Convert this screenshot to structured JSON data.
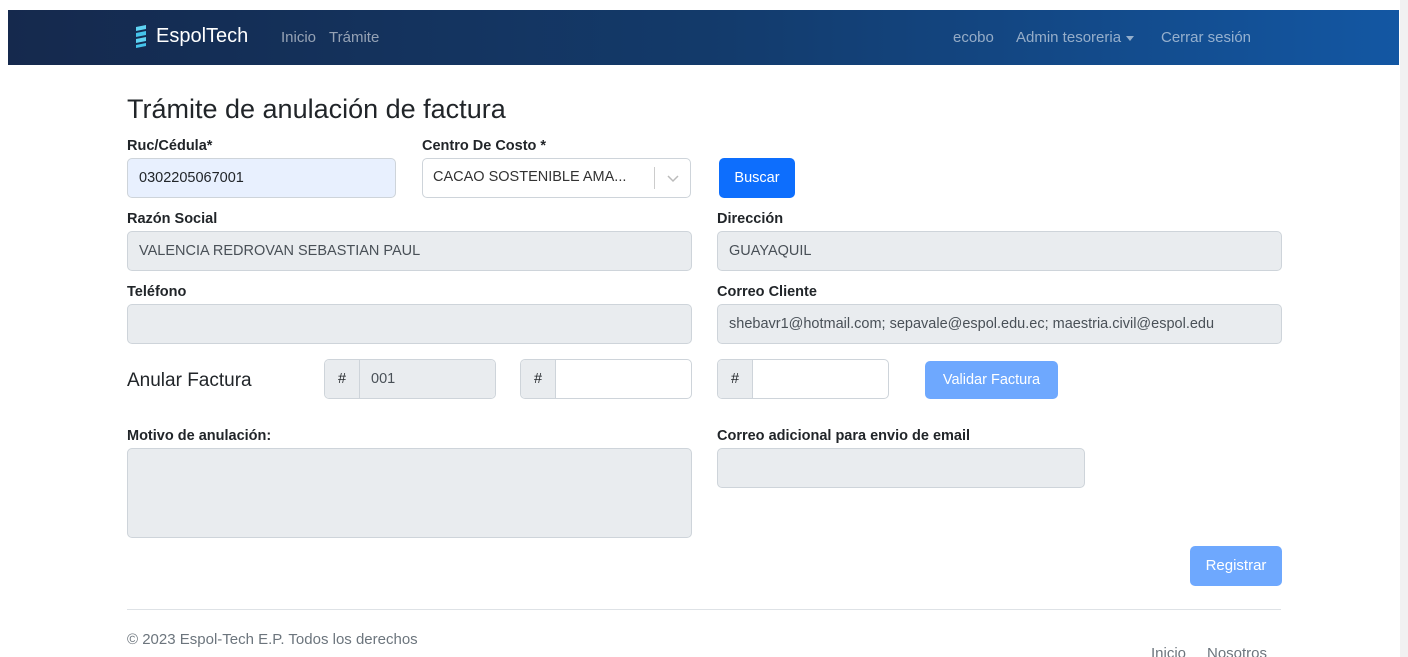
{
  "navbar": {
    "brand": "EspolTech",
    "links": [
      "Inicio",
      "Trámite"
    ],
    "user": "ecobo",
    "role_menu": "Admin tesoreria",
    "logout": "Cerrar sesión"
  },
  "page": {
    "title": "Trámite de anulación de factura"
  },
  "form": {
    "ruc_label": "Ruc/Cédula*",
    "ruc_value": "0302205067001",
    "centro_label": "Centro De Costo *",
    "centro_value": "CACAO SOSTENIBLE AMA...",
    "buscar_button": "Buscar",
    "razon_label": "Razón Social",
    "razon_value": "VALENCIA REDROVAN SEBASTIAN PAUL",
    "direccion_label": "Dirección",
    "direccion_value": "GUAYAQUIL",
    "telefono_label": "Teléfono",
    "telefono_value": "",
    "correo_label": "Correo Cliente",
    "correo_value": "shebavr1@hotmail.com; sepavale@espol.edu.ec; maestria.civil@espol.edu",
    "anular_label": "Anular Factura",
    "hash_prefix": "#",
    "factura_part1": "001",
    "factura_part2": "",
    "factura_part3": "",
    "validar_button": "Validar Factura",
    "motivo_label": "Motivo de anulación:",
    "motivo_value": "",
    "correo_adicional_label": "Correo adicional para envio de email",
    "correo_adicional_value": "",
    "registrar_button": "Registrar"
  },
  "footer": {
    "copyright": "© 2023 Espol-Tech E.P. Todos los derechos",
    "links": [
      "Inicio",
      "Nosotros"
    ]
  },
  "colors": {
    "navbar_start": "#15294d",
    "navbar_end": "#1357a3",
    "primary": "#0d6efd",
    "primary_disabled": "#6ea8fe",
    "readonly_bg": "#e9ecef"
  }
}
